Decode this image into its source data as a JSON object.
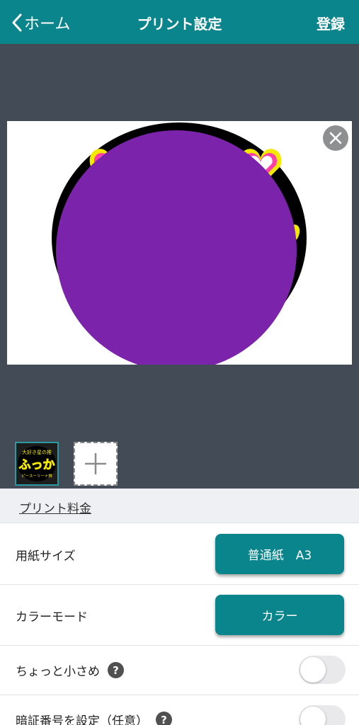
{
  "nav": {
    "back_label": "ホーム",
    "title": "プリント設定",
    "register_label": "登録"
  },
  "editor": {
    "close_icon": "close-icon",
    "add_icon": "plus-icon",
    "thumbnail": {
      "top_text": "大好き星の推",
      "main_text": "ふっか",
      "bottom_text": "ピースーリーナ推"
    }
  },
  "pricing": {
    "link_label": "プリント料金"
  },
  "settings": {
    "paper_size": {
      "label": "用紙サイズ",
      "value": "普通紙　A3"
    },
    "color_mode": {
      "label": "カラーモード",
      "value": "カラー"
    },
    "slightly_smaller": {
      "label": "ちょっと小さめ",
      "help": "?",
      "enabled": false
    },
    "pin": {
      "label": "暗証番号を設定（任意）",
      "help": "?",
      "enabled": false
    }
  },
  "colors": {
    "accent": "#0b858c",
    "editor_bg": "#434c56",
    "circle_purple": "#7b23ab"
  }
}
